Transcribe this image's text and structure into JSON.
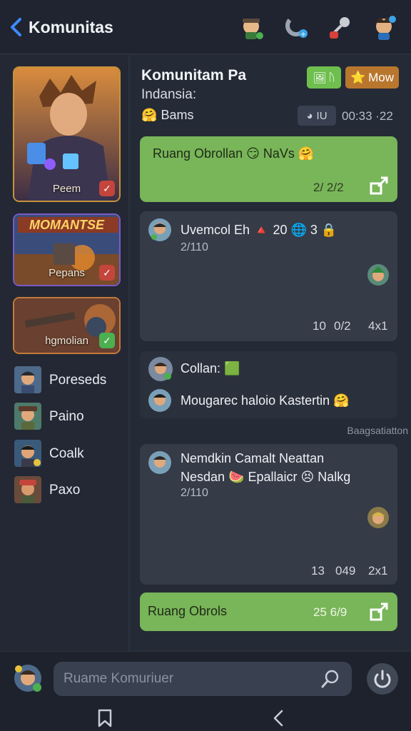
{
  "header": {
    "title": "Komunitas",
    "icons": [
      "avatar-bot-icon",
      "magnet-icon",
      "microphone-icon",
      "avatar-hero-icon"
    ]
  },
  "sidebar": {
    "cards": [
      {
        "label": "Peem",
        "badge": "check"
      },
      {
        "label": "Pepans",
        "banner": "MOMANTSE",
        "badge": "check"
      },
      {
        "label": "hgmolian",
        "badge": "check"
      }
    ],
    "members": [
      {
        "name": "Poreseds"
      },
      {
        "name": "Paino"
      },
      {
        "name": "Coalk"
      },
      {
        "name": "Paxo"
      }
    ]
  },
  "group": {
    "title": "Komunitam Pa",
    "subtitle": "Indansia:",
    "user": "Bams",
    "chip_a": "ᚢ",
    "chip_b": "Mow",
    "tag": "IU",
    "time": "00:33 ·22"
  },
  "messages": [
    {
      "text": "Ruang Obrollan 😏 NaVs 🤗",
      "meta": "2/  2/2"
    },
    {
      "text": "Uvemcol Eh 🔺 20 🌐 3 🔒",
      "sub": "2/110",
      "meta_a": "10",
      "meta_b": "0/2",
      "meta_c": "4x1"
    },
    {
      "text_a": "Collan: 🟩",
      "text_b": "Mougarec haloio Kastertin 🤗"
    },
    {
      "text_a": "Nemdkin Camalt Neattan",
      "text_b": "Nesdan 🍉 Epallaicr 😣 Nalkg",
      "sub": "2/110",
      "meta_a": "13",
      "meta_b": "049",
      "meta_c": "2x1"
    },
    {
      "text": "Ruang Obrols",
      "meta": "25  6/9"
    }
  ],
  "section_label": "Baagsatiatton",
  "composer": {
    "placeholder": "Ruame Komuriuer"
  },
  "colors": {
    "bg": "#242a36",
    "green_bubble": "#79b559",
    "dark_bubble": "#353b47",
    "accent_blue": "#3d8bfd"
  }
}
